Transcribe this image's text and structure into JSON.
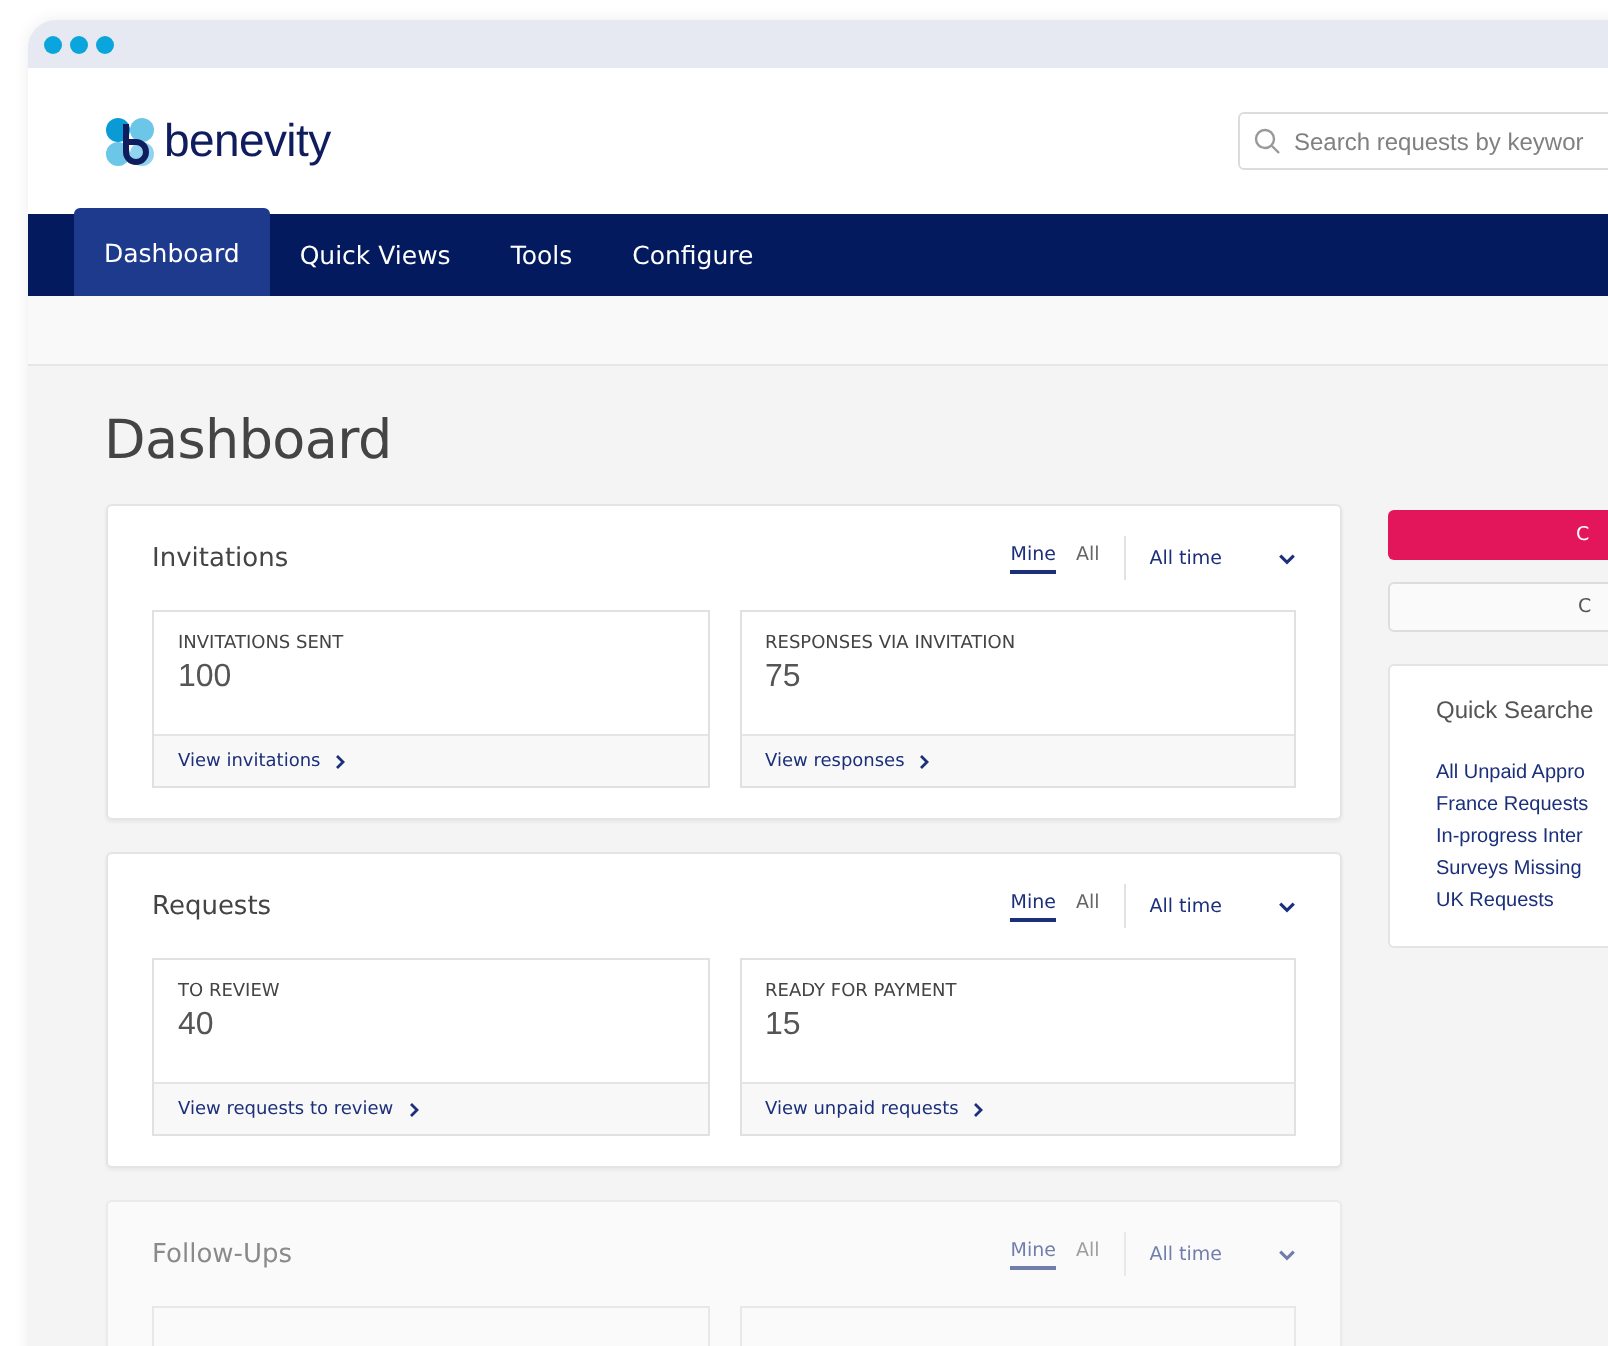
{
  "header": {
    "logo_text": "benevity",
    "search": {
      "placeholder": "Search requests by keywor"
    }
  },
  "nav": [
    {
      "label": "Dashboard",
      "selected": true
    },
    {
      "label": "Quick Views",
      "selected": false
    },
    {
      "label": "Tools",
      "selected": false
    },
    {
      "label": "Configure",
      "selected": false
    }
  ],
  "page_title": "Dashboard",
  "panels": [
    {
      "title": "Invitations",
      "faded": false,
      "filters": [
        {
          "label": "Mine",
          "selected": true
        },
        {
          "label": "All",
          "selected": false
        }
      ],
      "period": "All time",
      "stats": [
        {
          "label": "INVITATIONS SENT",
          "value": "100",
          "link": "View invitations"
        },
        {
          "label": "RESPONSES VIA INVITATION",
          "value": "75",
          "link": "View responses"
        }
      ]
    },
    {
      "title": "Requests",
      "faded": false,
      "filters": [
        {
          "label": "Mine",
          "selected": true
        },
        {
          "label": "All",
          "selected": false
        }
      ],
      "period": "All time",
      "stats": [
        {
          "label": "TO REVIEW",
          "value": "40",
          "link": "View requests to review"
        },
        {
          "label": "READY FOR PAYMENT",
          "value": "15",
          "link": "View unpaid requests"
        }
      ]
    },
    {
      "title": "Follow-Ups",
      "faded": true,
      "filters": [
        {
          "label": "Mine",
          "selected": true
        },
        {
          "label": "All",
          "selected": false
        }
      ],
      "period": "All time"
    }
  ],
  "sidebar": {
    "primary_button": "C",
    "secondary_button": "C",
    "quick_searches": {
      "title": "Quick Searche",
      "items": [
        "All Unpaid Appro",
        "France Requests",
        "In-progress Inter",
        "Surveys Missing",
        "UK Requests"
      ]
    }
  }
}
